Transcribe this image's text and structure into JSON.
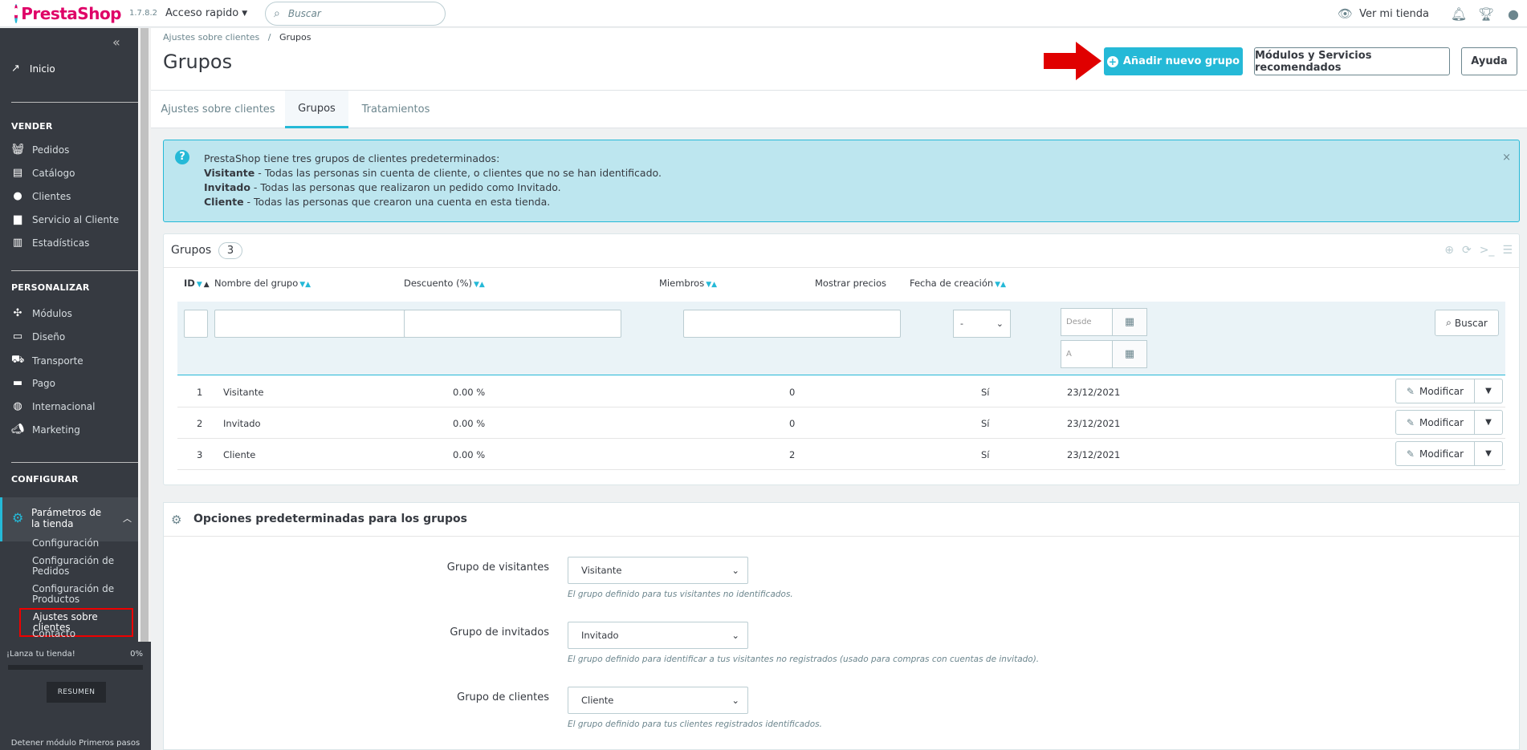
{
  "header": {
    "brand": "PrestaShop",
    "version": "1.7.8.2",
    "quick_access": "Acceso rapido",
    "search_placeholder": "Buscar",
    "view_store": "Ver mi tienda"
  },
  "sidebar": {
    "home": "Inicio",
    "sections": [
      {
        "title": "VENDER",
        "items": [
          "Pedidos",
          "Catálogo",
          "Clientes",
          "Servicio al Cliente",
          "Estadísticas"
        ]
      },
      {
        "title": "PERSONALIZAR",
        "items": [
          "Módulos",
          "Diseño",
          "Transporte",
          "Pago",
          "Internacional",
          "Marketing"
        ]
      },
      {
        "title": "CONFIGURAR",
        "items": []
      }
    ],
    "active_item": "Parámetros de la tienda",
    "sub_items": [
      "Configuración",
      "Configuración de Pedidos",
      "Configuración de Productos",
      "Ajustes sobre clientes",
      "Contacto"
    ],
    "launch_label": "¡Lanza tu tienda!",
    "launch_percent": "0%",
    "launch_progress": 0,
    "resumen": "RESUMEN",
    "stop_module": "Detener módulo Primeros pasos"
  },
  "page": {
    "breadcrumb_parent": "Ajustes sobre clientes",
    "breadcrumb_current": "Grupos",
    "title": "Grupos",
    "add_button": "Añadir nuevo grupo",
    "modules_button": "Módulos y Servicios recomendados",
    "help_button": "Ayuda",
    "tabs": [
      "Ajustes sobre clientes",
      "Grupos",
      "Tratamientos"
    ]
  },
  "alert": {
    "intro": "PrestaShop tiene tres grupos de clientes predeterminados:",
    "lines": [
      {
        "bold": "Visitante",
        "text": " - Todas las personas sin cuenta de cliente, o clientes que no se han identificado."
      },
      {
        "bold": "Invitado",
        "text": " - Todas las personas que realizaron un pedido como Invitado."
      },
      {
        "bold": "Cliente",
        "text": " - Todas las personas que crearon una cuenta en esta tienda."
      }
    ]
  },
  "groups_table": {
    "title": "Grupos",
    "count": "3",
    "columns": [
      "ID",
      "Nombre del grupo",
      "Descuento (%)",
      "Miembros",
      "Mostrar precios",
      "Fecha de creación"
    ],
    "filter_select_value": "-",
    "date_from_placeholder": "Desde",
    "date_to_placeholder": "A",
    "search_button": "Buscar",
    "edit_label": "Modificar",
    "rows": [
      {
        "id": "1",
        "name": "Visitante",
        "discount": "0.00 %",
        "members": "0",
        "show_prices": "Sí",
        "date": "23/12/2021"
      },
      {
        "id": "2",
        "name": "Invitado",
        "discount": "0.00 %",
        "members": "0",
        "show_prices": "Sí",
        "date": "23/12/2021"
      },
      {
        "id": "3",
        "name": "Cliente",
        "discount": "0.00 %",
        "members": "2",
        "show_prices": "Sí",
        "date": "23/12/2021"
      }
    ]
  },
  "options": {
    "title": "Opciones predeterminadas para los grupos",
    "fields": [
      {
        "label": "Grupo de visitantes",
        "value": "Visitante",
        "help": "El grupo definido para tus visitantes no identificados."
      },
      {
        "label": "Grupo de invitados",
        "value": "Invitado",
        "help": "El grupo definido para identificar a tus visitantes no registrados (usado para compras con cuentas de invitado)."
      },
      {
        "label": "Grupo de clientes",
        "value": "Cliente",
        "help": "El grupo definido para tus clientes registrados identificados."
      }
    ]
  },
  "colors": {
    "accent": "#25b9d7",
    "brand": "#df0067",
    "sidebar": "#363a41",
    "highlight": "#e00000"
  }
}
